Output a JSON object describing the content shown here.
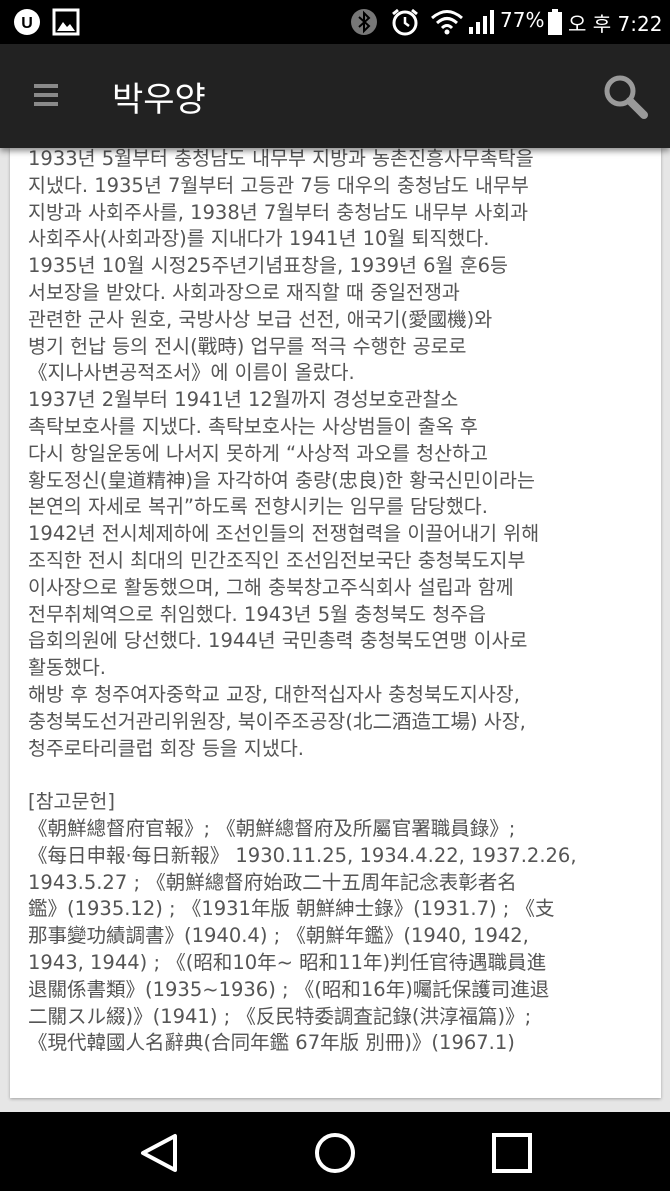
{
  "status_bar": {
    "battery_percent": "77%",
    "time": "오 후 7:22",
    "icons": [
      "u-plus-icon",
      "gallery-icon",
      "bluetooth-icon",
      "alarm-icon",
      "wifi-icon",
      "signal-icon",
      "battery-icon"
    ]
  },
  "app_bar": {
    "title": "박우양",
    "menu_icon": "hamburger-menu-icon",
    "search_icon": "search-icon"
  },
  "article": {
    "lines": [
      "1933년 5월부터 충청남도 내무부 지방과 농촌진흥사무촉탁을",
      "지냈다. 1935년 7월부터 고등관 7등 대우의 충청남도 내무부",
      "지방과 사회주사를, 1938년 7월부터 충청남도 내무부 사회과",
      "사회주사(사회과장)를 지내다가 1941년 10월 퇴직했다.",
      "1935년 10월 시정25주년기념표창을, 1939년 6월 훈6등",
      "서보장을 받았다. 사회과장으로 재직할 때 중일전쟁과",
      "관련한 군사 원호, 국방사상 보급 선전, 애국기(愛國機)와",
      "병기 헌납 등의 전시(戰時) 업무를 적극 수행한 공로로",
      "《지나사변공적조서》에 이름이 올랐다.",
      "1937년 2월부터 1941년 12월까지 경성보호관찰소",
      "촉탁보호사를 지냈다. 촉탁보호사는 사상범들이 출옥 후",
      "다시 항일운동에 나서지 못하게 “사상적 과오를 청산하고",
      "황도정신(皇道精神)을 자각하여 충량(忠良)한 황국신민이라는",
      "본연의 자세로 복귀”하도록 전향시키는 임무를 담당했다.",
      "1942년 전시체제하에 조선인들의 전쟁협력을 이끌어내기 위해",
      "조직한 전시 최대의 민간조직인 조선임전보국단 충청북도지부",
      "이사장으로 활동했으며, 그해 충북창고주식회사 설립과 함께",
      "전무취체역으로 취임했다. 1943년 5월 충청북도 청주읍",
      "읍회의원에 당선했다. 1944년 국민총력 충청북도연맹 이사로",
      "활동했다.",
      "해방 후 청주여자중학교 교장, 대한적십자사 충청북도지사장,",
      "충청북도선거관리위원장, 북이주조공장(北二酒造工場) 사장,",
      "청주로타리클럽 회장 등을 지냈다.",
      "",
      "[참고문헌]",
      "《朝鮮總督府官報》; 《朝鮮總督府及所屬官署職員錄》;",
      "《每日申報·每日新報》 1930.11.25, 1934.4.22, 1937.2.26,",
      "1943.5.27 ; 《朝鮮總督府始政二十五周年記念表彰者名",
      "鑑》(1935.12) ; 《1931年版 朝鮮紳士錄》(1931.7) ; 《支",
      "那事變功績調書》(1940.4) ; 《朝鮮年鑑》(1940, 1942,",
      "1943, 1944) ; 《(昭和10年~ 昭和11年)判任官待遇職員進",
      "退關係書類》(1935~1936) ; 《(昭和16年)囑託保護司進退",
      "二關スル綴)》(1941) ; 《反民特委調査記錄(洪淳福篇)》;",
      "《現代韓國人名辭典(合同年鑑 67年版 別冊)》(1967.1)"
    ]
  },
  "nav_bar": {
    "icons": [
      "back-icon",
      "home-icon",
      "recents-icon"
    ]
  },
  "colors": {
    "status_bar": "#000000",
    "app_bar": "#222222",
    "page_bg": "#e6e6e6",
    "card_bg": "#ffffff",
    "text": "#555555"
  }
}
